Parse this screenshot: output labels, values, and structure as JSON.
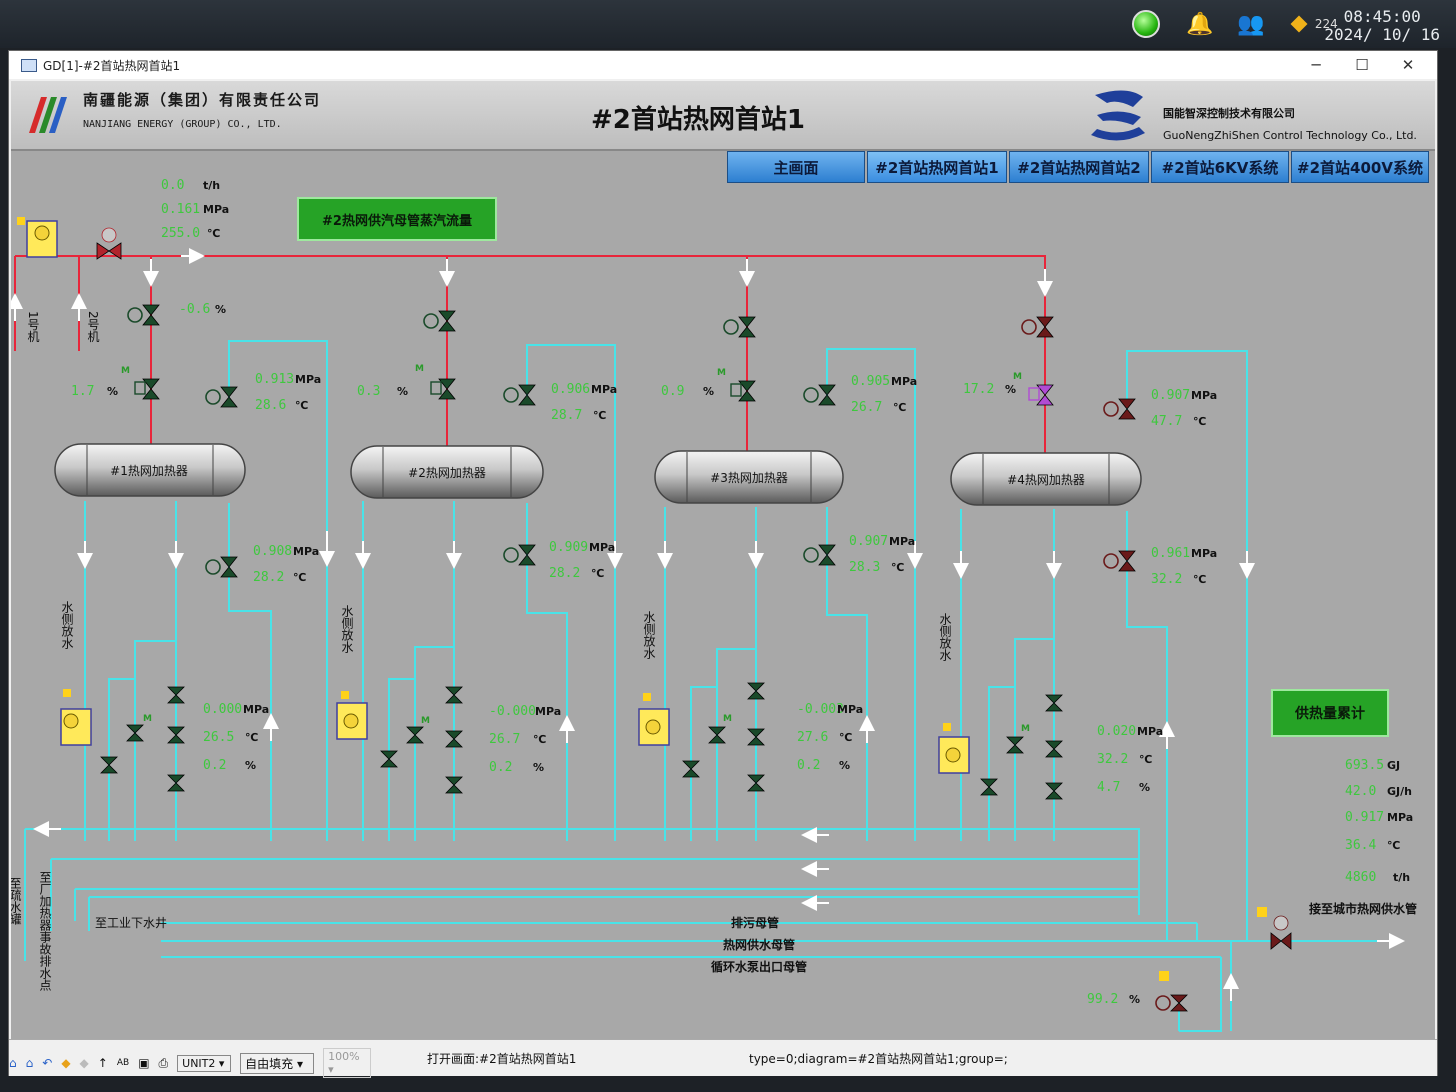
{
  "taskbar": {
    "badge_count": "224",
    "time": "08:45:00",
    "date": "2024/ 10/ 16"
  },
  "window": {
    "title": "GD[1]-#2首站热网首站1"
  },
  "header": {
    "company_cn": "南疆能源（集团）有限责任公司",
    "company_en": "NANJIANG ENERGY (GROUP) CO., LTD.",
    "page_title": "#2首站热网首站1",
    "partner_cn": "国能智深控制技术有限公司",
    "partner_en": "GuoNengZhiShen Control Technology Co., Ltd."
  },
  "nav": [
    "主画面",
    "#2首站热网首站1",
    "#2首站热网首站2",
    "#2首站6KV系统",
    "#2首站400V系统"
  ],
  "steam": {
    "flow": "0.0",
    "flow_unit": "t/h",
    "pressure": "0.161",
    "pressure_unit": "MPa",
    "temp": "255.0",
    "temp_unit": "℃",
    "button": "#2热网供汽母管蒸汽流量",
    "unit1": "1号机",
    "unit2": "2号机",
    "main_valve_pct": "-0.6",
    "pct_unit": "%"
  },
  "heaters": [
    {
      "name": "#1热网加热器",
      "valve_pct": "1.7",
      "in_p": "0.913",
      "in_t": "28.6",
      "out_p": "0.908",
      "out_t": "28.2",
      "bot_p": "0.000",
      "bot_t": "26.5",
      "bot_pct": "0.2"
    },
    {
      "name": "#2热网加热器",
      "valve_pct": "0.3",
      "in_p": "0.906",
      "in_t": "28.7",
      "out_p": "0.909",
      "out_t": "28.2",
      "bot_p": "-0.000",
      "bot_t": "26.7",
      "bot_pct": "0.2"
    },
    {
      "name": "#3热网加热器",
      "valve_pct": "0.9",
      "in_p": "0.905",
      "in_t": "26.7",
      "out_p": "0.907",
      "out_t": "28.3",
      "bot_p": "-0.003",
      "bot_t": "27.6",
      "bot_pct": "0.2"
    },
    {
      "name": "#4热网加热器",
      "valve_pct": "17.2",
      "in_p": "0.907",
      "in_t": "47.7",
      "out_p": "0.961",
      "out_t": "32.2",
      "bot_p": "0.020",
      "bot_t": "32.2",
      "bot_pct": "4.7"
    }
  ],
  "labels": {
    "water_drain": "水侧放水",
    "to_drain_tank": "至疏水罐",
    "to_plant_heater": "至厂加热器事故排水点",
    "to_industrial": "至工业下水井",
    "sewage_header": "排污母管",
    "supply_header": "热网供水母管",
    "pump_outlet": "循环水泵出口母管",
    "to_city": "接至城市热网供水管",
    "bottom_valve_pct": "99.2",
    "m_tag": "M"
  },
  "accum": {
    "button": "供热量累计",
    "heat": "693.5",
    "heat_unit": "GJ",
    "rate": "42.0",
    "rate_unit": "GJ/h",
    "pressure": "0.917",
    "pressure_unit": "MPa",
    "temp": "36.4",
    "temp_unit": "℃",
    "flow": "4860",
    "flow_unit": "t/h"
  },
  "status": {
    "unit_select": "UNIT2",
    "fill_select": "自由填充",
    "zoom": "100%",
    "message": "打开画面:#2首站热网首站1",
    "info": "type=0;diagram=#2首站热网首站1;group=;"
  },
  "colors": {
    "steam_line": "#e8253a",
    "water_line": "#49e3e8",
    "value_text": "#3ec83e",
    "nav_button": "#2d7fd1",
    "accum_button": "#2aa52a"
  }
}
